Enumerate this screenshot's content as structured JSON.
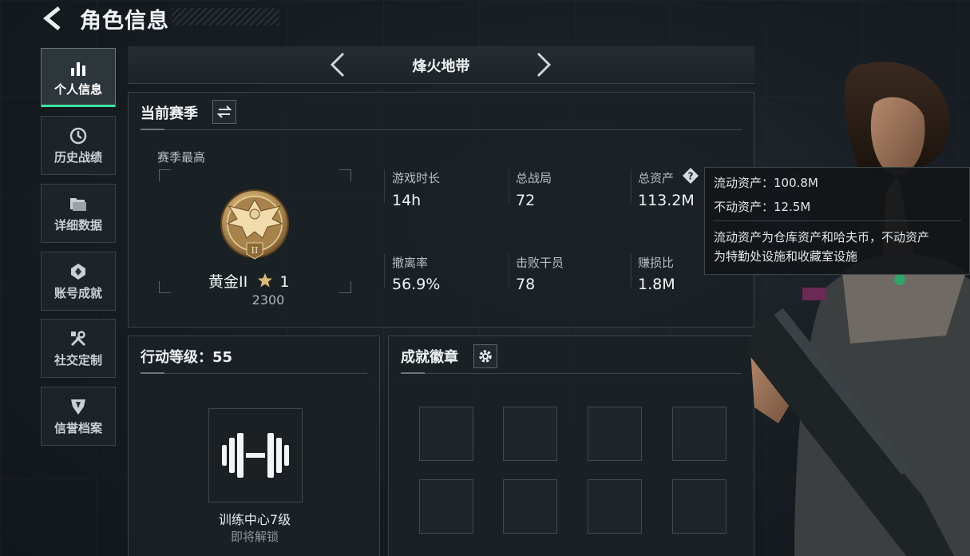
{
  "header": {
    "title": "角色信息"
  },
  "sidebar": {
    "items": [
      {
        "label": "个人信息",
        "icon": "bar-chart-icon",
        "active": true
      },
      {
        "label": "历史战绩",
        "icon": "history-icon",
        "active": false
      },
      {
        "label": "详细数据",
        "icon": "folder-icon",
        "active": false
      },
      {
        "label": "账号成就",
        "icon": "achievement-icon",
        "active": false
      },
      {
        "label": "社交定制",
        "icon": "tools-icon",
        "active": false
      },
      {
        "label": "信誉档案",
        "icon": "credit-shield-icon",
        "active": false
      }
    ]
  },
  "mode_selector": {
    "name": "烽火地带"
  },
  "season": {
    "title": "当前赛季",
    "best_label": "赛季最高",
    "rank_name": "黄金II",
    "rank_stars": "1",
    "rank_score": "2300",
    "stats": [
      {
        "label": "游戏时长",
        "value": "14h"
      },
      {
        "label": "总战局",
        "value": "72"
      },
      {
        "label": "总资产",
        "value": "113.2M"
      },
      {
        "label": "撤离率",
        "value": "56.9%"
      },
      {
        "label": "击败干员",
        "value": "78"
      },
      {
        "label": "赚损比",
        "value": "1.8M"
      }
    ]
  },
  "tooltip": {
    "liquid": "流动资产：100.8M",
    "fixed": "不动资产：12.5M",
    "desc_line1": "流动资产为仓库资产和哈夫币，不动资产",
    "desc_line2": "为特勤处设施和收藏室设施"
  },
  "action_level": {
    "title": "行动等级：55",
    "training_name": "训练中心7级",
    "training_status": "即将解锁"
  },
  "badges": {
    "title": "成就徽章"
  },
  "colors": {
    "accent": "#3ee2a0",
    "medal_gold": "#c8a46a"
  }
}
